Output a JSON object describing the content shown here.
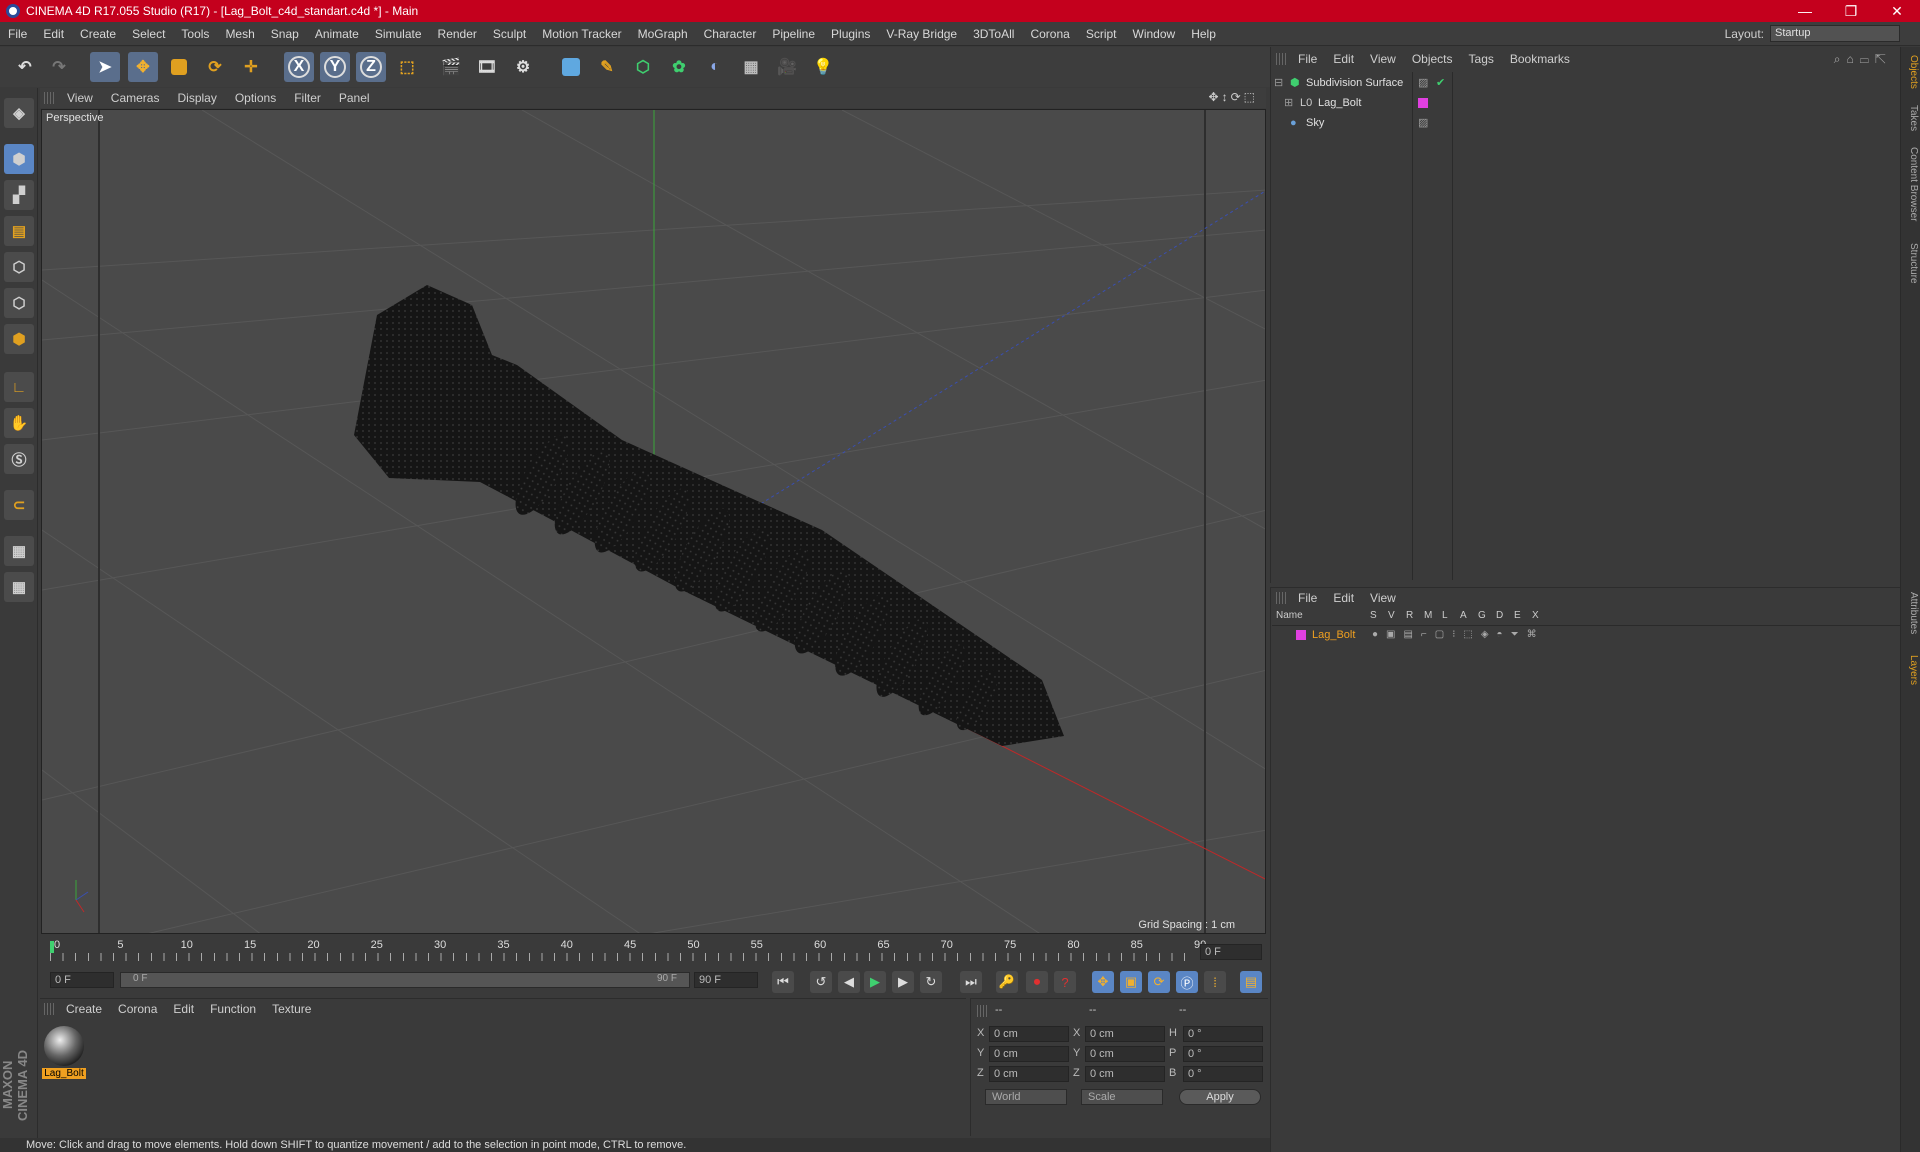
{
  "window": {
    "title": "CINEMA 4D R17.055 Studio (R17) - [Lag_Bolt_c4d_standart.c4d *] - Main"
  },
  "menubar": [
    "File",
    "Edit",
    "Create",
    "Select",
    "Tools",
    "Mesh",
    "Snap",
    "Animate",
    "Simulate",
    "Render",
    "Sculpt",
    "Motion Tracker",
    "MoGraph",
    "Character",
    "Pipeline",
    "Plugins",
    "V-Ray Bridge",
    "3DToAll",
    "Corona",
    "Script",
    "Window",
    "Help"
  ],
  "layout": {
    "label": "Layout:",
    "value": "Startup"
  },
  "toolbar": {
    "x_label": "X",
    "y_label": "Y",
    "z_label": "Z"
  },
  "viewport": {
    "menu": [
      "View",
      "Cameras",
      "Display",
      "Options",
      "Filter",
      "Panel"
    ],
    "label": "Perspective",
    "grid_spacing": "Grid Spacing : 1 cm"
  },
  "timeline": {
    "ticks": [
      "0",
      "5",
      "10",
      "15",
      "20",
      "25",
      "30",
      "35",
      "40",
      "45",
      "50",
      "55",
      "60",
      "65",
      "70",
      "75",
      "80",
      "85",
      "90"
    ],
    "current_frame": "0 F",
    "start_field": "0 F",
    "slider_start": "0 F",
    "slider_end": "90 F",
    "end_field": "90 F"
  },
  "material_panel": {
    "menu": [
      "Create",
      "Corona",
      "Edit",
      "Function",
      "Texture"
    ],
    "materials": [
      {
        "name": "Lag_Bolt"
      }
    ]
  },
  "coord_panel": {
    "header": [
      "--",
      "--",
      "--"
    ],
    "rows": [
      {
        "a": "X",
        "v1": "0 cm",
        "b": "X",
        "v2": "0 cm",
        "c": "H",
        "v3": "0 °"
      },
      {
        "a": "Y",
        "v1": "0 cm",
        "b": "Y",
        "v2": "0 cm",
        "c": "P",
        "v3": "0 °"
      },
      {
        "a": "Z",
        "v1": "0 cm",
        "b": "Z",
        "v2": "0 cm",
        "c": "B",
        "v3": "0 °"
      }
    ],
    "world": "World",
    "scale": "Scale",
    "apply": "Apply"
  },
  "status": "Move: Click and drag to move elements. Hold down SHIFT to quantize movement / add to the selection in point mode, CTRL to remove.",
  "object_manager": {
    "menu": [
      "File",
      "Edit",
      "View",
      "Objects",
      "Tags",
      "Bookmarks"
    ],
    "objects": [
      {
        "name": "Subdivision Surface"
      },
      {
        "name": "Lag_Bolt"
      },
      {
        "name": "Sky"
      }
    ]
  },
  "layer_manager": {
    "menu": [
      "File",
      "Edit",
      "View"
    ],
    "columns": [
      "Name",
      "S",
      "V",
      "R",
      "M",
      "L",
      "A",
      "G",
      "D",
      "E",
      "X"
    ],
    "layers": [
      {
        "name": "Lag_Bolt",
        "color": "#e040e0"
      }
    ]
  },
  "right_tabs": [
    "Objects",
    "Takes",
    "Content Browser",
    "Structure",
    "Attributes",
    "Layers"
  ],
  "brand": "MAXON CINEMA 4D",
  "colors": {
    "title_bar": "#c4001d",
    "accent": "#5a86c5",
    "layer": "#e040e0"
  }
}
